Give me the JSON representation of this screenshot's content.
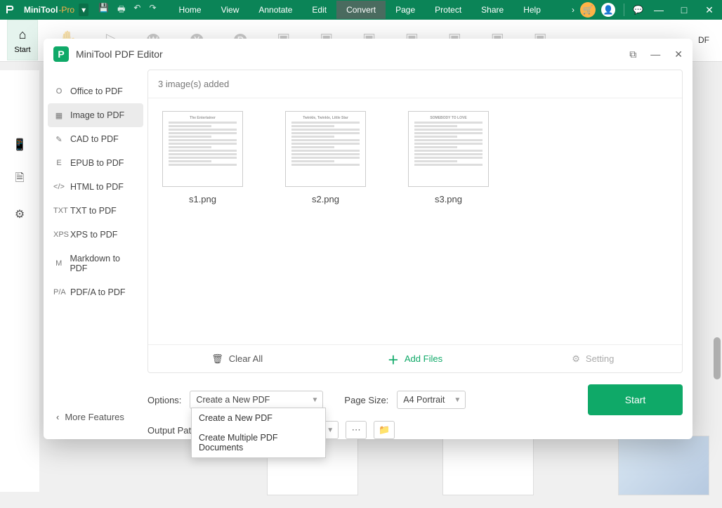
{
  "titlebar": {
    "brand": "MiniTool",
    "brand_suffix": "-Pro",
    "menus": [
      "Home",
      "View",
      "Annotate",
      "Edit",
      "Convert",
      "Page",
      "Protect",
      "Share",
      "Help"
    ],
    "active_menu_index": 4
  },
  "ribbon": {
    "start_label": "Start",
    "end_label": "DF"
  },
  "dialog": {
    "title": "MiniTool PDF Editor",
    "sidebar_items": [
      {
        "icon": "O",
        "label": "Office to PDF"
      },
      {
        "icon": "▦",
        "label": "Image to PDF"
      },
      {
        "icon": "✎",
        "label": "CAD to PDF"
      },
      {
        "icon": "E",
        "label": "EPUB to PDF"
      },
      {
        "icon": "</>",
        "label": "HTML to PDF"
      },
      {
        "icon": "TXT",
        "label": "TXT to PDF"
      },
      {
        "icon": "XPS",
        "label": "XPS to PDF"
      },
      {
        "icon": "M",
        "label": "Markdown to PDF"
      },
      {
        "icon": "P/A",
        "label": "PDF/A to PDF"
      }
    ],
    "active_sidebar_index": 1,
    "more_features": "More Features",
    "content_header": "3 image(s) added",
    "thumbs": [
      {
        "name": "s1.png",
        "title": "The Entertainer"
      },
      {
        "name": "s2.png",
        "title": "Twinkle, Twinkle, Little Star"
      },
      {
        "name": "s3.png",
        "title": "SOMEBODY TO LOVE"
      }
    ],
    "footer": {
      "clear": "Clear All",
      "add": "Add Files",
      "setting": "Setting"
    },
    "options_label": "Options:",
    "options_value": "Create a New PDF",
    "pagesize_label": "Page Size:",
    "pagesize_value": "A4 Portrait",
    "output_label": "Output Pat",
    "start_btn": "Start"
  },
  "dropdown": {
    "items": [
      "Create a New PDF",
      "Create Multiple PDF Documents"
    ]
  }
}
